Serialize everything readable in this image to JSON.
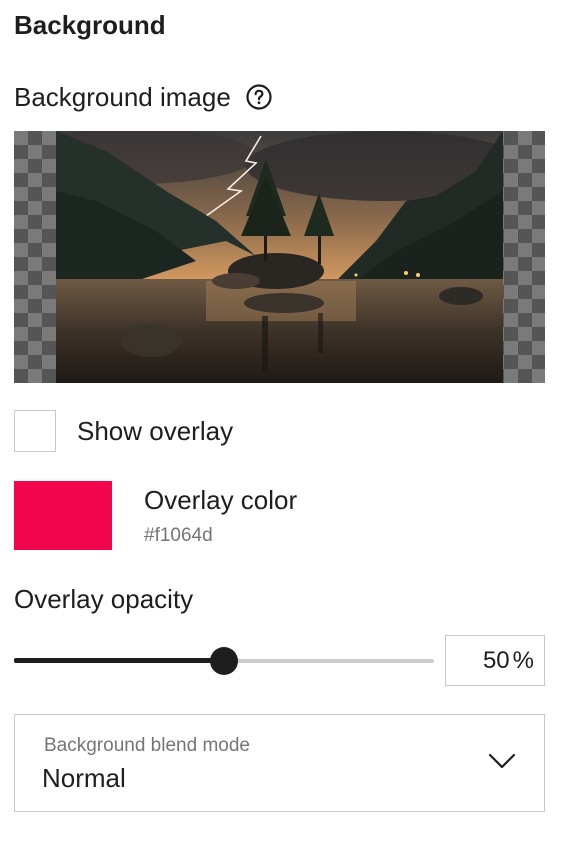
{
  "heading": "Background",
  "background_image": {
    "label": "Background image",
    "help_icon": "question-circle-icon"
  },
  "show_overlay": {
    "label": "Show overlay",
    "checked": false
  },
  "overlay_color": {
    "label": "Overlay color",
    "hex": "#f1064d",
    "swatch_color": "#f1064d"
  },
  "overlay_opacity": {
    "label": "Overlay opacity",
    "value": "50",
    "unit": "%",
    "fraction": 0.5
  },
  "blend_mode": {
    "label": "Background blend mode",
    "value": "Normal",
    "icon": "chevron-down-icon"
  }
}
